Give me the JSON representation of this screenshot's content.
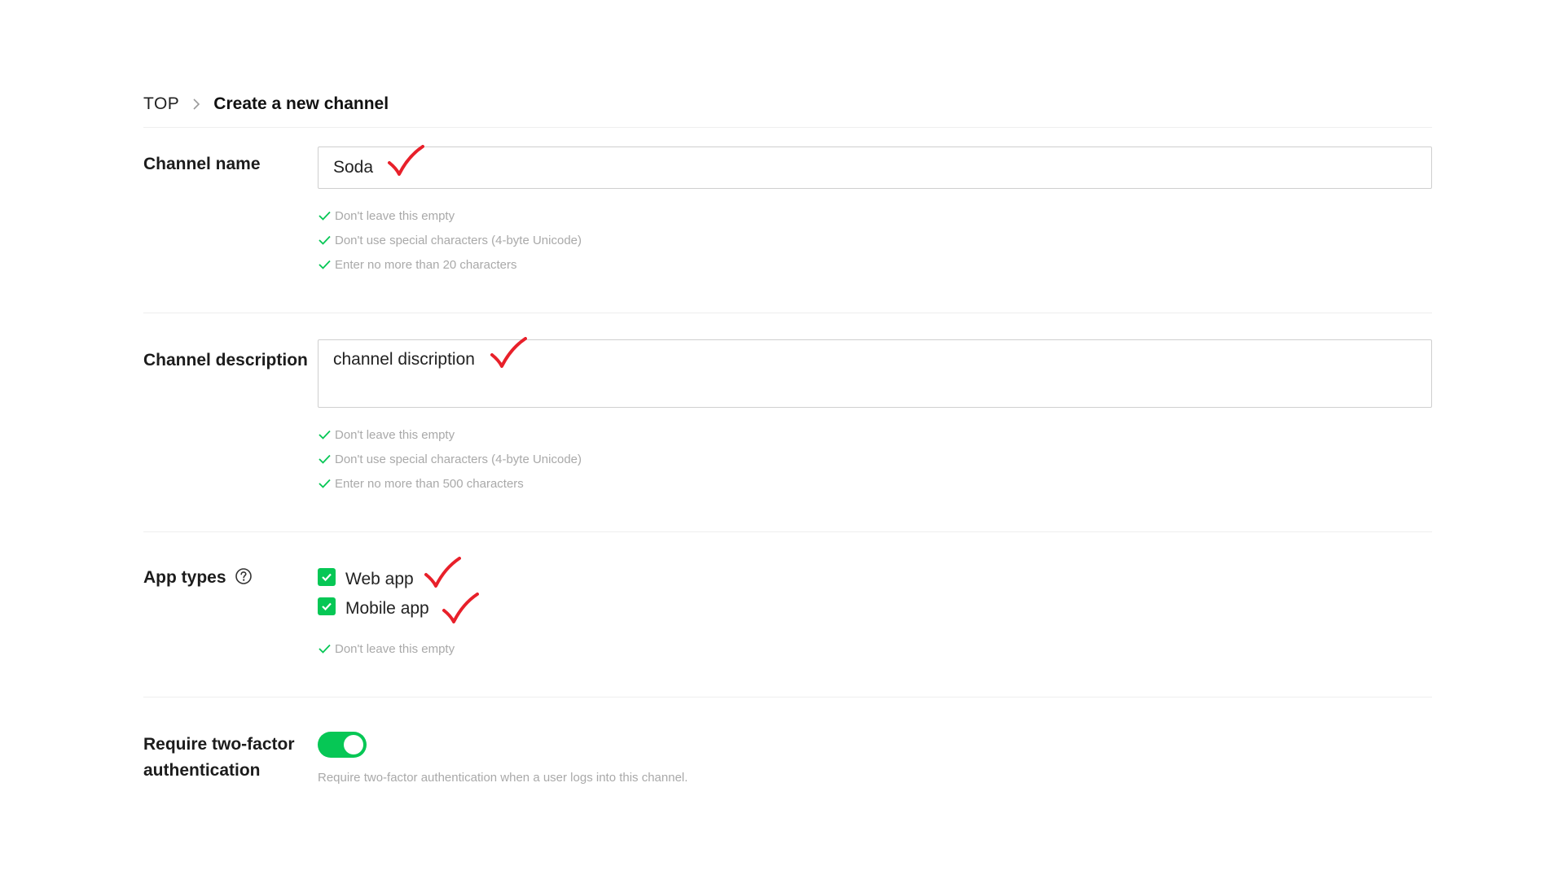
{
  "breadcrumb": {
    "root": "TOP",
    "current": "Create a new channel"
  },
  "channel_name": {
    "label": "Channel name",
    "value": "Soda",
    "rules": [
      "Don't leave this empty",
      "Don't use special characters (4-byte Unicode)",
      "Enter no more than 20 characters"
    ]
  },
  "channel_description": {
    "label": "Channel description",
    "value": "channel discription",
    "rules": [
      "Don't leave this empty",
      "Don't use special characters (4-byte Unicode)",
      "Enter no more than 500 characters"
    ]
  },
  "app_types": {
    "label": "App types",
    "options": [
      {
        "label": "Web app",
        "checked": true
      },
      {
        "label": "Mobile app",
        "checked": true
      }
    ],
    "rules": [
      "Don't leave this empty"
    ]
  },
  "two_factor": {
    "label_line1": "Require two-factor",
    "label_line2": "authentication",
    "enabled": true,
    "description": "Require two-factor authentication when a user logs into this channel."
  },
  "colors": {
    "accent": "#06c755",
    "annotation": "#e8202a",
    "hint": "#a9a9a9"
  }
}
